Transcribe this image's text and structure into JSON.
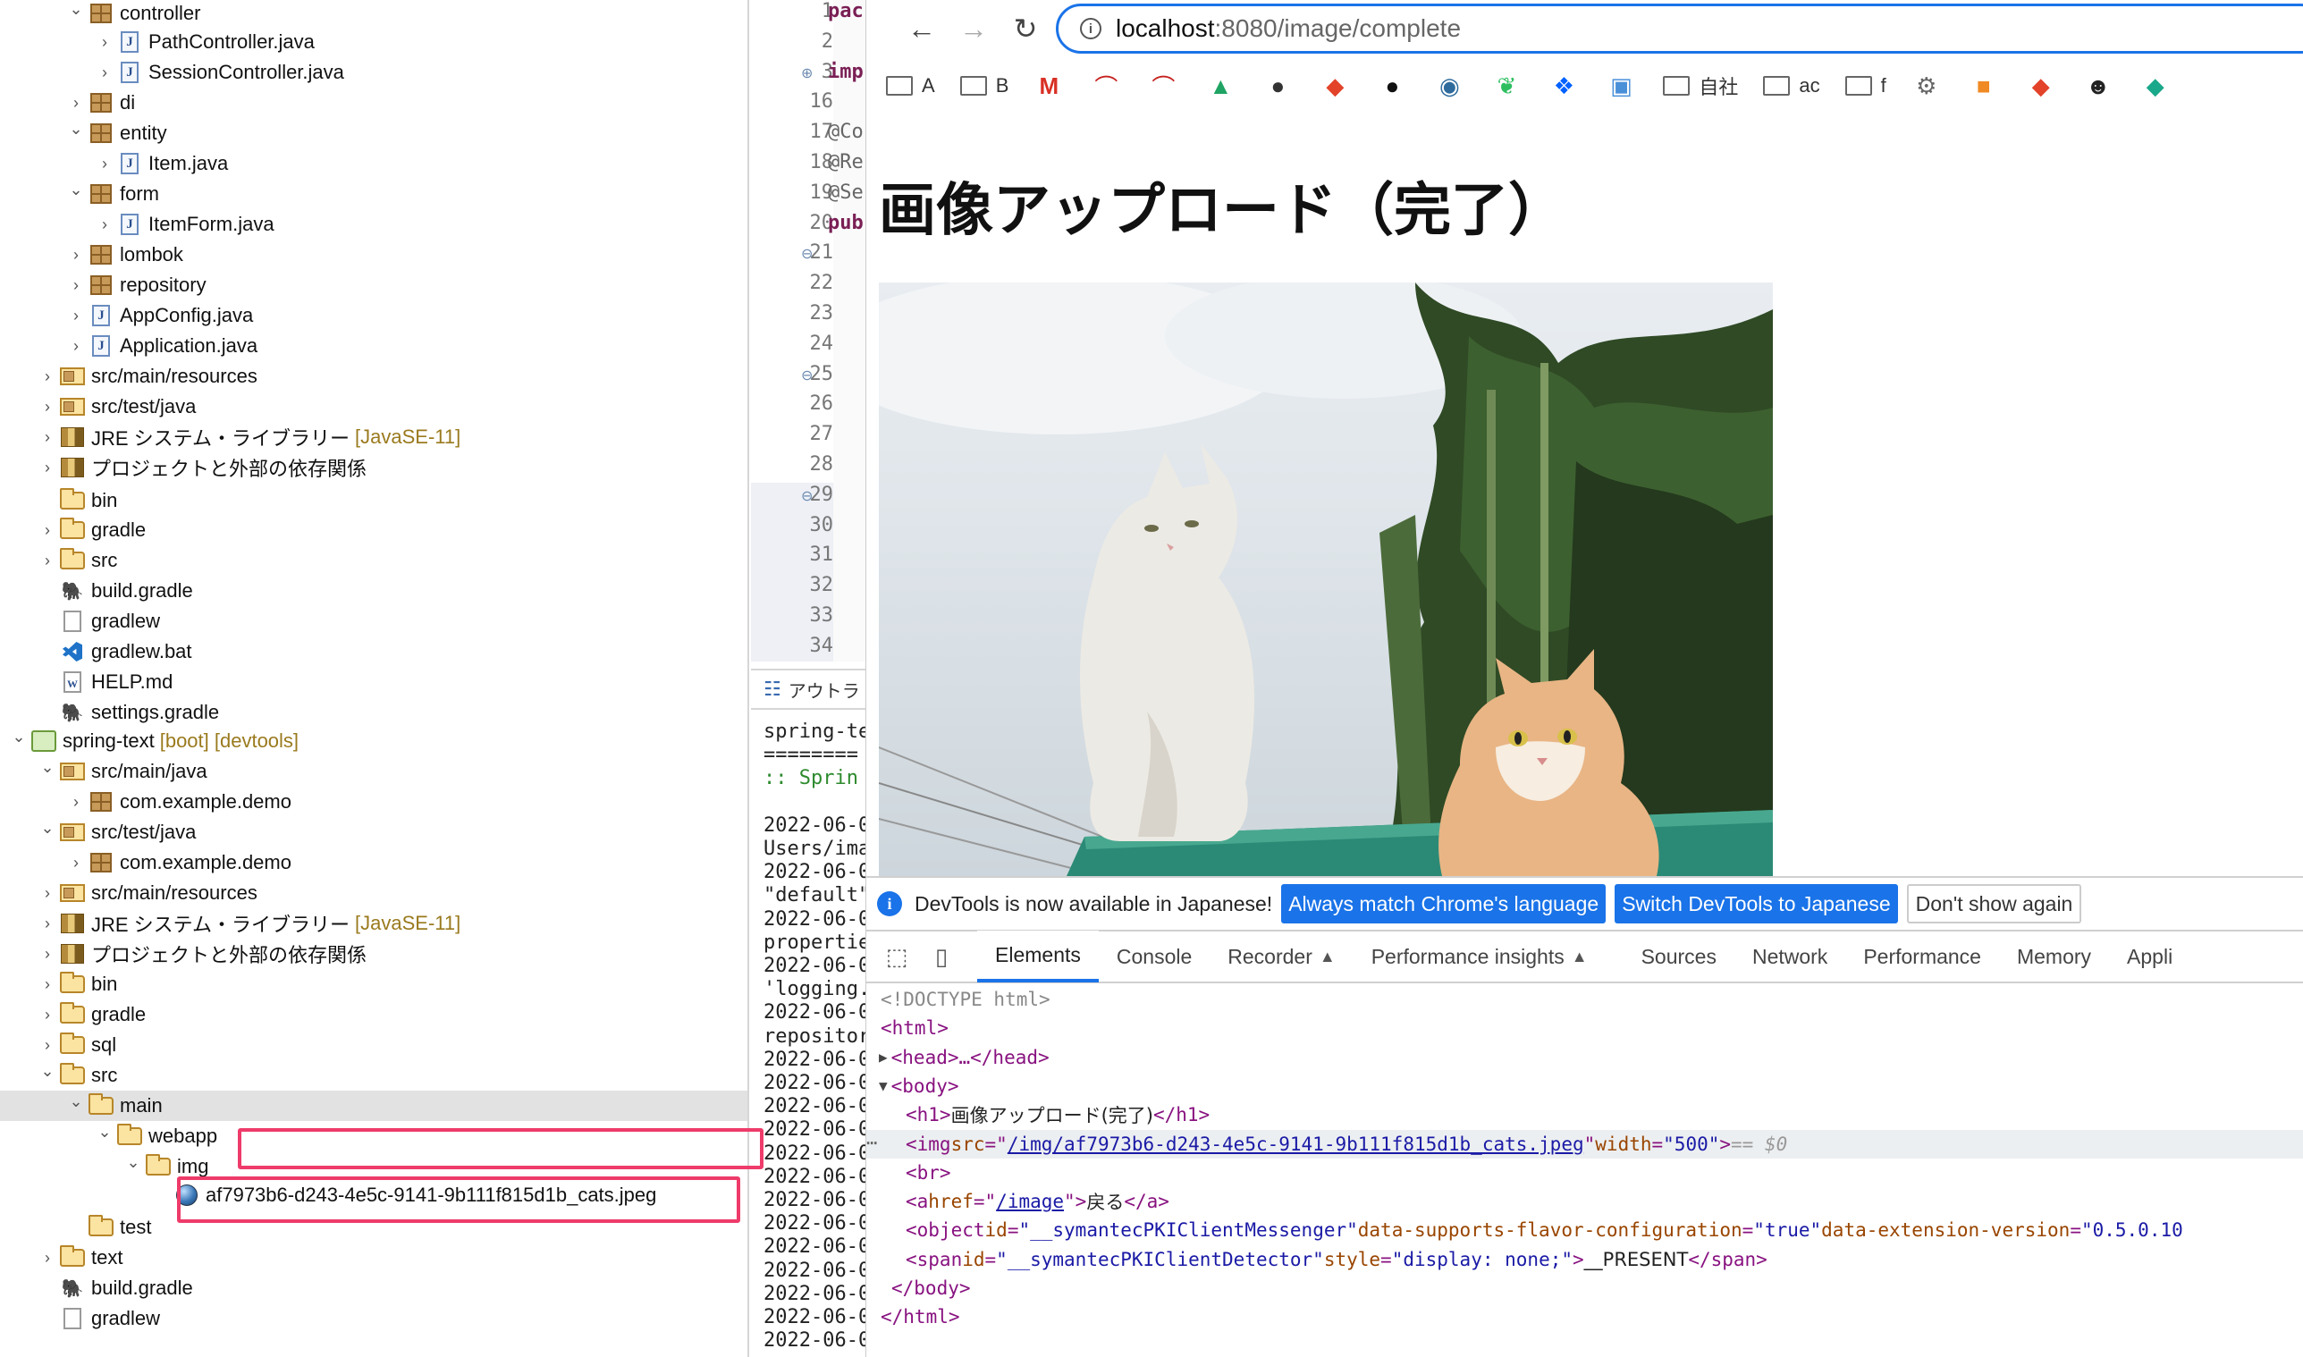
{
  "explorer": {
    "rows": [
      {
        "label": "controller",
        "deco": ""
      },
      {
        "label": "PathController.java",
        "deco": ""
      },
      {
        "label": "SessionController.java",
        "deco": ""
      },
      {
        "label": "di",
        "deco": ""
      },
      {
        "label": "entity",
        "deco": ""
      },
      {
        "label": "Item.java",
        "deco": ""
      },
      {
        "label": "form",
        "deco": ""
      },
      {
        "label": "ItemForm.java",
        "deco": ""
      },
      {
        "label": "lombok",
        "deco": ""
      },
      {
        "label": "repository",
        "deco": ""
      },
      {
        "label": "AppConfig.java",
        "deco": ""
      },
      {
        "label": "Application.java",
        "deco": ""
      },
      {
        "label": "src/main/resources",
        "deco": ""
      },
      {
        "label": "src/test/java",
        "deco": ""
      },
      {
        "label": "JRE システム・ライブラリー",
        "deco": "[JavaSE-11]"
      },
      {
        "label": "プロジェクトと外部の依存関係",
        "deco": ""
      },
      {
        "label": "bin",
        "deco": ""
      },
      {
        "label": "gradle",
        "deco": ""
      },
      {
        "label": "src",
        "deco": ""
      },
      {
        "label": "build.gradle",
        "deco": ""
      },
      {
        "label": "gradlew",
        "deco": ""
      },
      {
        "label": "gradlew.bat",
        "deco": ""
      },
      {
        "label": "HELP.md",
        "deco": ""
      },
      {
        "label": "settings.gradle",
        "deco": ""
      },
      {
        "label": "spring-text",
        "deco": "[boot] [devtools]"
      },
      {
        "label": "src/main/java",
        "deco": ""
      },
      {
        "label": "com.example.demo",
        "deco": ""
      },
      {
        "label": "src/test/java",
        "deco": ""
      },
      {
        "label": "com.example.demo",
        "deco": ""
      },
      {
        "label": "src/main/resources",
        "deco": ""
      },
      {
        "label": "JRE システム・ライブラリー",
        "deco": "[JavaSE-11]"
      },
      {
        "label": "プロジェクトと外部の依存関係",
        "deco": ""
      },
      {
        "label": "bin",
        "deco": ""
      },
      {
        "label": "gradle",
        "deco": ""
      },
      {
        "label": "sql",
        "deco": ""
      },
      {
        "label": "src",
        "deco": ""
      },
      {
        "label": "main",
        "deco": ""
      },
      {
        "label": "webapp",
        "deco": ""
      },
      {
        "label": "img",
        "deco": ""
      },
      {
        "label": "af7973b6-d243-4e5c-9141-9b111f815d1b_cats.jpeg",
        "deco": ""
      },
      {
        "label": "test",
        "deco": ""
      },
      {
        "label": "text",
        "deco": ""
      },
      {
        "label": "build.gradle",
        "deco": ""
      },
      {
        "label": "gradlew",
        "deco": ""
      }
    ]
  },
  "editor": {
    "lines": [
      {
        "num": "1",
        "code": "pac",
        "ann": false
      },
      {
        "num": "2",
        "code": "",
        "ann": false
      },
      {
        "num": "3",
        "code": "imp",
        "ann": false
      },
      {
        "num": "16",
        "code": "",
        "ann": false
      },
      {
        "num": "17",
        "code": "@Co",
        "ann": true
      },
      {
        "num": "18",
        "code": "@Re",
        "ann": true
      },
      {
        "num": "19",
        "code": "@Se",
        "ann": true
      },
      {
        "num": "20",
        "code": "pub",
        "ann": false
      },
      {
        "num": "21",
        "code": "",
        "ann": false
      },
      {
        "num": "22",
        "code": "",
        "ann": false
      },
      {
        "num": "23",
        "code": "",
        "ann": false
      },
      {
        "num": "24",
        "code": "",
        "ann": false
      },
      {
        "num": "25",
        "code": "",
        "ann": false
      },
      {
        "num": "26",
        "code": "",
        "ann": false
      },
      {
        "num": "27",
        "code": "",
        "ann": false
      },
      {
        "num": "28",
        "code": "",
        "ann": false
      },
      {
        "num": "29",
        "code": "",
        "ann": false
      },
      {
        "num": "30",
        "code": "",
        "ann": false
      },
      {
        "num": "31",
        "code": "",
        "ann": false
      },
      {
        "num": "32",
        "code": "",
        "ann": false
      },
      {
        "num": "33",
        "code": "",
        "ann": false
      },
      {
        "num": "34",
        "code": "",
        "ann": false
      }
    ],
    "outline_label": "アウトラ",
    "console": [
      "spring-text",
      "========",
      " :: Sprin",
      "",
      "2022-06-0",
      "Users/ima",
      "2022-06-0",
      "\"default\"",
      "2022-06-0",
      "propertie",
      "2022-06-0",
      "'logging.",
      "2022-06-0",
      "repositor",
      "2022-06-0",
      "2022-06-0",
      "2022-06-0",
      "2022-06-0",
      "2022-06-0",
      "2022-06-0",
      "2022-06-0",
      "2022-06-0",
      "2022-06-0",
      "2022-06-0",
      "2022-06-0",
      "2022-06-0",
      "2022-06-0"
    ]
  },
  "browser": {
    "url_host": "localhost",
    "url_rest": ":8080/image/complete",
    "bookmarks": [
      {
        "type": "folder",
        "label": "A"
      },
      {
        "type": "folder",
        "label": "B"
      },
      {
        "type": "icon",
        "icon": "gmail-icon"
      },
      {
        "type": "icon",
        "icon": "arc-icon"
      },
      {
        "type": "icon",
        "icon": "arc-icon"
      },
      {
        "type": "icon",
        "icon": "drive-icon"
      },
      {
        "type": "icon",
        "icon": "globe-icon"
      },
      {
        "type": "icon",
        "icon": "gitlab-icon"
      },
      {
        "type": "icon",
        "icon": "github-icon"
      },
      {
        "type": "icon",
        "icon": "docker-icon"
      },
      {
        "type": "icon",
        "icon": "evernote-icon"
      },
      {
        "type": "icon",
        "icon": "dropbox-icon"
      },
      {
        "type": "icon",
        "icon": "app-icon"
      },
      {
        "type": "folder",
        "label": "自社"
      },
      {
        "type": "folder",
        "label": "ac"
      },
      {
        "type": "folder",
        "label": "f"
      },
      {
        "type": "icon",
        "icon": "gear-icon"
      },
      {
        "type": "icon",
        "icon": "cube-icon"
      },
      {
        "type": "icon",
        "icon": "gitlab-icon"
      },
      {
        "type": "icon",
        "icon": "ghost-icon"
      },
      {
        "type": "icon",
        "icon": "diamond-icon"
      }
    ],
    "page_heading": "画像アップロード（完了）",
    "image_alt": "cats",
    "devtools_banner": {
      "message": "DevTools is now available in Japanese!",
      "btn_match": "Always match Chrome's language",
      "btn_switch": "Switch DevTools to Japanese",
      "btn_dismiss": "Don't show again"
    },
    "devtools_tabs": [
      "Elements",
      "Console",
      "Recorder",
      "Performance insights",
      "Sources",
      "Network",
      "Performance",
      "Memory",
      "Appli"
    ],
    "dom": {
      "doctype": "<!DOCTYPE html>",
      "html_open": "<html>",
      "head": "<head>…</head>",
      "body_open": "<body>",
      "h1_open": "<h1>",
      "h1_text": "画像アップロード(完了)",
      "h1_close": "</h1>",
      "img_open": "<img ",
      "src_attr": "src",
      "src_path": "/img/",
      "src_file": "af7973b6-d243-4e5c-9141-9b111f815d1b_cats.jpeg",
      "width_attr": "width",
      "width_val": "\"500\"",
      "img_close": ">",
      "eq": "== $0",
      "br": "<br>",
      "a_open": "<a ",
      "href_attr": "href",
      "href_val": "/image",
      "a_text": "戻る",
      "a_close": "</a>",
      "object_open": "<object ",
      "object_id_attr": "id",
      "object_id_val": "\"__symantecPKIClientMessenger\"",
      "object_attr2": "data-supports-flavor-configuration",
      "object_val2": "\"true\"",
      "object_attr3": "data-extension-version",
      "object_val3": "\"0.5.0.10",
      "span_open": "<span ",
      "span_id_attr": "id",
      "span_id_val": "\"__symantecPKIClientDetector\"",
      "span_style_attr": "style",
      "span_style_val": "\"display: none;\"",
      "span_text": "__PRESENT",
      "span_close": "</span>",
      "body_close": "</body>",
      "html_close": "</html>"
    }
  }
}
